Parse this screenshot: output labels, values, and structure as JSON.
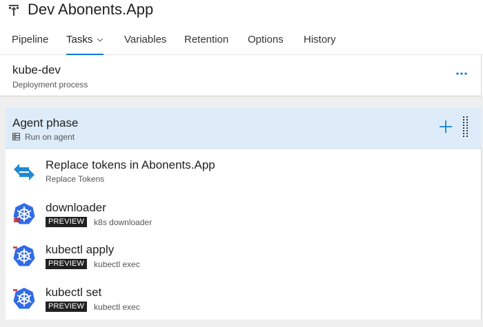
{
  "header": {
    "title": "Dev Abonents.App"
  },
  "tabs": [
    {
      "label": "Pipeline"
    },
    {
      "label": "Tasks"
    },
    {
      "label": "Variables"
    },
    {
      "label": "Retention"
    },
    {
      "label": "Options"
    },
    {
      "label": "History"
    }
  ],
  "environment": {
    "name": "kube-dev",
    "subtitle": "Deployment process"
  },
  "phase": {
    "title": "Agent phase",
    "subtitle": "Run on agent"
  },
  "tasks": [
    {
      "name": "Replace tokens in Abonents.App",
      "badge": "",
      "subtitle": "Replace Tokens",
      "icon": "replace-tokens-icon"
    },
    {
      "name": "downloader",
      "badge": "PREVIEW",
      "subtitle": "k8s downloader",
      "icon": "kubernetes-icon"
    },
    {
      "name": "kubectl apply",
      "badge": "PREVIEW",
      "subtitle": "kubectl exec",
      "icon": "kubernetes-icon"
    },
    {
      "name": "kubectl set",
      "badge": "PREVIEW",
      "subtitle": "kubectl exec",
      "icon": "kubernetes-icon"
    }
  ],
  "colors": {
    "accent": "#0078d4",
    "phase_bg": "#deecf9",
    "k8s_blue": "#326ce5",
    "badge_bg": "#212121"
  }
}
